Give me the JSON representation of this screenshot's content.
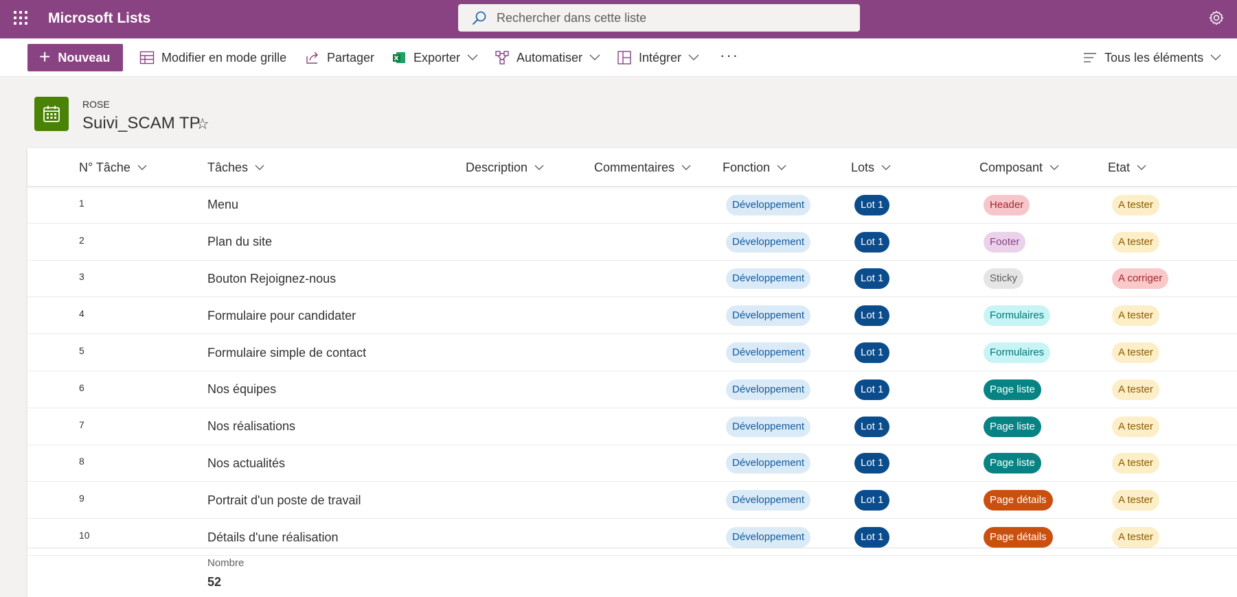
{
  "suitebar": {
    "app_title": "Microsoft Lists",
    "search_placeholder": "Rechercher dans cette liste",
    "color": "#894382"
  },
  "commandbar": {
    "new_label": "Nouveau",
    "grid_label": "Modifier en mode grille",
    "share_label": "Partager",
    "export_label": "Exporter",
    "automate_label": "Automatiser",
    "integrate_label": "Intégrer",
    "more_label": "···",
    "view_label": "Tous les éléments"
  },
  "list": {
    "subtitle": "ROSE",
    "title": "Suivi_SCAM TP",
    "icon": "calendar-icon"
  },
  "columns": [
    "N° Tâche",
    "Tâches",
    "Description",
    "Commentaires",
    "Fonction",
    "Lots",
    "Composant",
    "Etat"
  ],
  "rows": [
    {
      "num": "1",
      "task": "Menu",
      "fonction": "Développement",
      "lot": "Lot 1",
      "composant": "Header",
      "etat": "A tester"
    },
    {
      "num": "2",
      "task": "Plan du site",
      "fonction": "Développement",
      "lot": "Lot 1",
      "composant": "Footer",
      "etat": "A tester"
    },
    {
      "num": "3",
      "task": "Bouton Rejoignez-nous",
      "fonction": "Développement",
      "lot": "Lot 1",
      "composant": "Sticky",
      "etat": "A corriger"
    },
    {
      "num": "4",
      "task": "Formulaire pour candidater",
      "fonction": "Développement",
      "lot": "Lot 1",
      "composant": "Formulaires",
      "etat": "A tester"
    },
    {
      "num": "5",
      "task": "Formulaire simple de contact",
      "fonction": "Développement",
      "lot": "Lot 1",
      "composant": "Formulaires",
      "etat": "A tester"
    },
    {
      "num": "6",
      "task": "Nos équipes",
      "fonction": "Développement",
      "lot": "Lot 1",
      "composant": "Page liste",
      "etat": "A tester"
    },
    {
      "num": "7",
      "task": "Nos réalisations",
      "fonction": "Développement",
      "lot": "Lot 1",
      "composant": "Page liste",
      "etat": "A tester"
    },
    {
      "num": "8",
      "task": "Nos actualités",
      "fonction": "Développement",
      "lot": "Lot 1",
      "composant": "Page liste",
      "etat": "A tester"
    },
    {
      "num": "9",
      "task": "Portrait d'un poste de travail",
      "fonction": "Développement",
      "lot": "Lot 1",
      "composant": "Page détails",
      "etat": "A tester"
    },
    {
      "num": "10",
      "task": "Détails d'une réalisation",
      "fonction": "Développement",
      "lot": "Lot 1",
      "composant": "Page détails",
      "etat": "A tester"
    }
  ],
  "pill_styles": {
    "Développement": {
      "bg": "#dbeaf7",
      "fg": "#0f5a9e"
    },
    "Lot 1": {
      "bg": "#0b4c8c",
      "fg": "#ffffff"
    },
    "Header": {
      "bg": "#f7c6ca",
      "fg": "#a4262c"
    },
    "Footer": {
      "bg": "#ead2ea",
      "fg": "#8a3f87"
    },
    "Sticky": {
      "bg": "#e5e5e5",
      "fg": "#605e5c"
    },
    "Formulaires": {
      "bg": "#c7f4f4",
      "fg": "#00757a"
    },
    "Page liste": {
      "bg": "#078383",
      "fg": "#ffffff"
    },
    "Page détails": {
      "bg": "#ca5010",
      "fg": "#ffffff"
    },
    "A tester": {
      "bg": "#fcefc7",
      "fg": "#8a5a00"
    },
    "A corriger": {
      "bg": "#f9c9c9",
      "fg": "#a4262c"
    }
  },
  "footer": {
    "label": "Nombre",
    "value": "52"
  }
}
